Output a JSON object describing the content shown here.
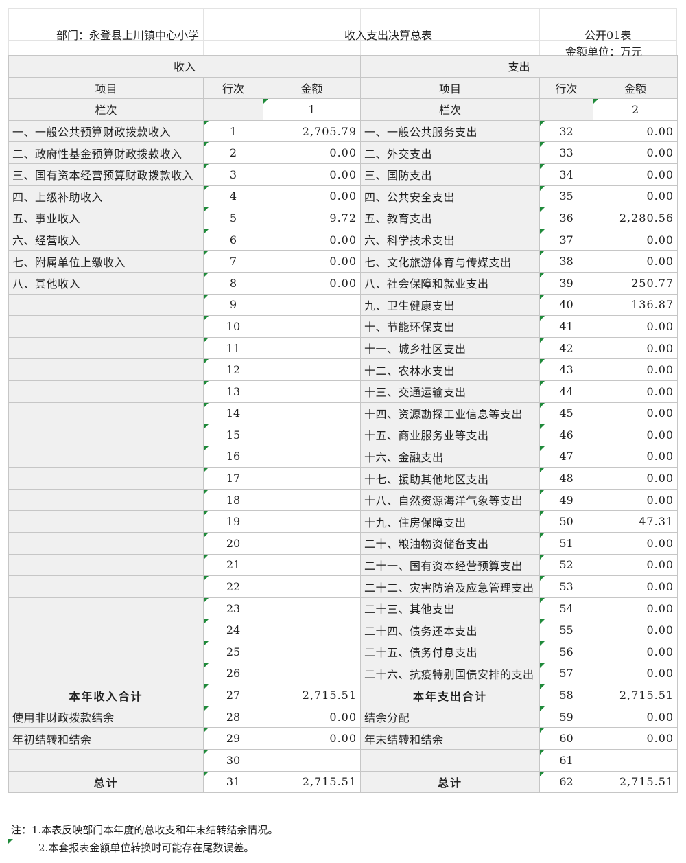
{
  "header": {
    "department": "部门：永登县上川镇中心小学",
    "title": "收入支出决算总表",
    "code": "公开01表",
    "unit": "金额单位：万元"
  },
  "sections": {
    "income": "收入",
    "expense": "支出"
  },
  "columns": {
    "item": "项目",
    "row_no": "行次",
    "amount": "金额"
  },
  "column_index": {
    "label": "栏次",
    "income_col": "1",
    "expense_col": "2"
  },
  "rows": [
    {
      "in_item": "一、一般公共预算财政拨款收入",
      "in_no": "1",
      "in_amt": "2,705.79",
      "ex_item": "一、一般公共服务支出",
      "ex_no": "32",
      "ex_amt": "0.00"
    },
    {
      "in_item": "二、政府性基金预算财政拨款收入",
      "in_no": "2",
      "in_amt": "0.00",
      "ex_item": "二、外交支出",
      "ex_no": "33",
      "ex_amt": "0.00"
    },
    {
      "in_item": "三、国有资本经营预算财政拨款收入",
      "in_no": "3",
      "in_amt": "0.00",
      "ex_item": "三、国防支出",
      "ex_no": "34",
      "ex_amt": "0.00"
    },
    {
      "in_item": "四、上级补助收入",
      "in_no": "4",
      "in_amt": "0.00",
      "ex_item": "四、公共安全支出",
      "ex_no": "35",
      "ex_amt": "0.00"
    },
    {
      "in_item": "五、事业收入",
      "in_no": "5",
      "in_amt": "9.72",
      "ex_item": "五、教育支出",
      "ex_no": "36",
      "ex_amt": "2,280.56"
    },
    {
      "in_item": "六、经营收入",
      "in_no": "6",
      "in_amt": "0.00",
      "ex_item": "六、科学技术支出",
      "ex_no": "37",
      "ex_amt": "0.00"
    },
    {
      "in_item": "七、附属单位上缴收入",
      "in_no": "7",
      "in_amt": "0.00",
      "ex_item": "七、文化旅游体育与传媒支出",
      "ex_no": "38",
      "ex_amt": "0.00"
    },
    {
      "in_item": "八、其他收入",
      "in_no": "8",
      "in_amt": "0.00",
      "ex_item": "八、社会保障和就业支出",
      "ex_no": "39",
      "ex_amt": "250.77"
    },
    {
      "in_item": "",
      "in_no": "9",
      "in_amt": "",
      "ex_item": "九、卫生健康支出",
      "ex_no": "40",
      "ex_amt": "136.87"
    },
    {
      "in_item": "",
      "in_no": "10",
      "in_amt": "",
      "ex_item": "十、节能环保支出",
      "ex_no": "41",
      "ex_amt": "0.00"
    },
    {
      "in_item": "",
      "in_no": "11",
      "in_amt": "",
      "ex_item": "十一、城乡社区支出",
      "ex_no": "42",
      "ex_amt": "0.00"
    },
    {
      "in_item": "",
      "in_no": "12",
      "in_amt": "",
      "ex_item": "十二、农林水支出",
      "ex_no": "43",
      "ex_amt": "0.00"
    },
    {
      "in_item": "",
      "in_no": "13",
      "in_amt": "",
      "ex_item": "十三、交通运输支出",
      "ex_no": "44",
      "ex_amt": "0.00"
    },
    {
      "in_item": "",
      "in_no": "14",
      "in_amt": "",
      "ex_item": "十四、资源勘探工业信息等支出",
      "ex_no": "45",
      "ex_amt": "0.00"
    },
    {
      "in_item": "",
      "in_no": "15",
      "in_amt": "",
      "ex_item": "十五、商业服务业等支出",
      "ex_no": "46",
      "ex_amt": "0.00"
    },
    {
      "in_item": "",
      "in_no": "16",
      "in_amt": "",
      "ex_item": "十六、金融支出",
      "ex_no": "47",
      "ex_amt": "0.00"
    },
    {
      "in_item": "",
      "in_no": "17",
      "in_amt": "",
      "ex_item": "十七、援助其他地区支出",
      "ex_no": "48",
      "ex_amt": "0.00"
    },
    {
      "in_item": "",
      "in_no": "18",
      "in_amt": "",
      "ex_item": "十八、自然资源海洋气象等支出",
      "ex_no": "49",
      "ex_amt": "0.00"
    },
    {
      "in_item": "",
      "in_no": "19",
      "in_amt": "",
      "ex_item": "十九、住房保障支出",
      "ex_no": "50",
      "ex_amt": "47.31"
    },
    {
      "in_item": "",
      "in_no": "20",
      "in_amt": "",
      "ex_item": "二十、粮油物资储备支出",
      "ex_no": "51",
      "ex_amt": "0.00"
    },
    {
      "in_item": "",
      "in_no": "21",
      "in_amt": "",
      "ex_item": "二十一、国有资本经营预算支出",
      "ex_no": "52",
      "ex_amt": "0.00"
    },
    {
      "in_item": "",
      "in_no": "22",
      "in_amt": "",
      "ex_item": "二十二、灾害防治及应急管理支出",
      "ex_no": "53",
      "ex_amt": "0.00"
    },
    {
      "in_item": "",
      "in_no": "23",
      "in_amt": "",
      "ex_item": "二十三、其他支出",
      "ex_no": "54",
      "ex_amt": "0.00"
    },
    {
      "in_item": "",
      "in_no": "24",
      "in_amt": "",
      "ex_item": "二十四、债务还本支出",
      "ex_no": "55",
      "ex_amt": "0.00"
    },
    {
      "in_item": "",
      "in_no": "25",
      "in_amt": "",
      "ex_item": "二十五、债务付息支出",
      "ex_no": "56",
      "ex_amt": "0.00"
    },
    {
      "in_item": "",
      "in_no": "26",
      "in_amt": "",
      "ex_item": "二十六、抗疫特别国债安排的支出",
      "ex_no": "57",
      "ex_amt": "0.00"
    }
  ],
  "year_total": {
    "in_item": "本年收入合计",
    "in_no": "27",
    "in_amt": "2,715.51",
    "ex_item": "本年支出合计",
    "ex_no": "58",
    "ex_amt": "2,715.51"
  },
  "extra_rows": [
    {
      "in_item": "使用非财政拨款结余",
      "in_no": "28",
      "in_amt": "0.00",
      "ex_item": "结余分配",
      "ex_no": "59",
      "ex_amt": "0.00"
    },
    {
      "in_item": "年初结转和结余",
      "in_no": "29",
      "in_amt": "0.00",
      "ex_item": "年末结转和结余",
      "ex_no": "60",
      "ex_amt": "0.00"
    },
    {
      "in_item": "",
      "in_no": "30",
      "in_amt": "",
      "ex_item": "",
      "ex_no": "61",
      "ex_amt": ""
    }
  ],
  "grand_total": {
    "in_item": "总计",
    "in_no": "31",
    "in_amt": "2,715.51",
    "ex_item": "总计",
    "ex_no": "62",
    "ex_amt": "2,715.51"
  },
  "notes": {
    "n1": "注：1.本表反映部门本年度的总收支和年末结转结余情况。",
    "n2": "2.本套报表金额单位转换时可能存在尾数误差。"
  }
}
